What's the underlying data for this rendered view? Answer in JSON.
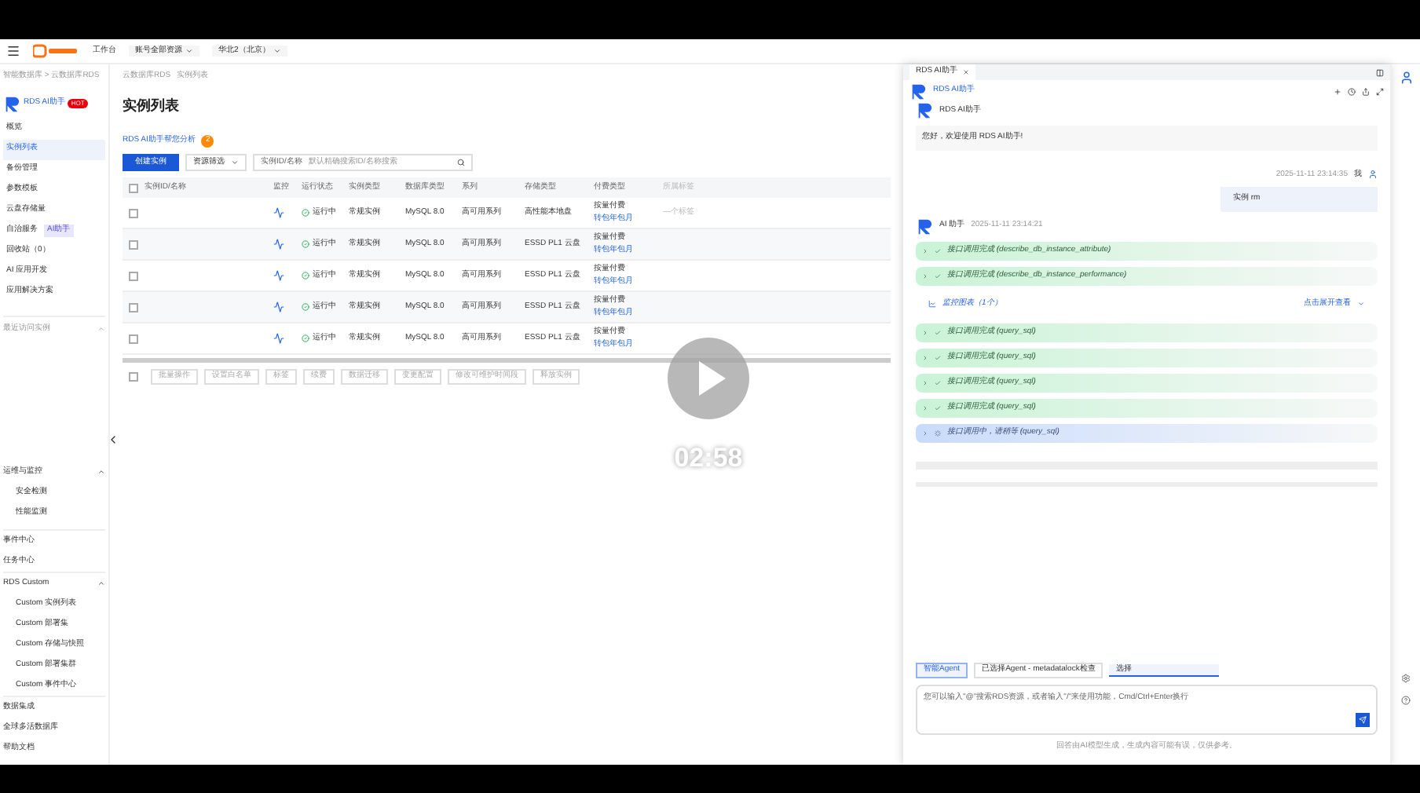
{
  "topbar": {
    "home": "工作台",
    "resources": "账号全部资源",
    "region": "华北2（北京）"
  },
  "sidebar": {
    "breadcrumb": "智能数据库 > 云数据库RDS",
    "assistant": "RDS AI助手",
    "badge": "HOT",
    "items": [
      {
        "label": "概览",
        "selected": false
      },
      {
        "label": "实例列表",
        "selected": true
      },
      {
        "label": "备份管理",
        "selected": false
      },
      {
        "label": "参数模板",
        "selected": false
      },
      {
        "label": "云盘存储量",
        "selected": false
      },
      {
        "label": "自治服务",
        "tag": "AI助手",
        "selected": false
      },
      {
        "label": "回收站（0）",
        "selected": false
      },
      {
        "label": "AI 应用开发",
        "selected": false
      },
      {
        "label": "应用解决方案",
        "selected": false
      }
    ],
    "recent": "最近访问实例",
    "groups": [
      {
        "title": "运维与监控",
        "items": [
          "安全检测",
          "性能监测"
        ]
      }
    ],
    "links": [
      "事件中心",
      "任务中心"
    ],
    "custom": {
      "title": "RDS Custom",
      "items": [
        "Custom 实例列表",
        "Custom 部署集",
        "Custom 存储与快照",
        "Custom 部署集群",
        "Custom 事件中心"
      ]
    },
    "footer": [
      "数据集成",
      "全球多活数据库",
      "帮助文档"
    ]
  },
  "main": {
    "breadcrumb": [
      "云数据库RDS",
      "实例列表"
    ],
    "title": "实例列表",
    "ai_link": "RDS AI助手帮您分析",
    "ai_count": "2",
    "create": "创建实例",
    "filter": "资源筛选",
    "search_select": "实例ID/名称",
    "search_placeholder": "默认精确搜索ID/名称搜索",
    "select_all": {
      "checked": false
    },
    "table": {
      "columns": [
        "实例ID/名称",
        "监控",
        "运行状态",
        "实例类型",
        "数据库类型",
        "系列",
        "存储类型",
        "付费类型",
        "所属标签"
      ],
      "rows": [
        {
          "status": "运行中",
          "type": "常规实例",
          "db": "MySQL 8.0",
          "series": "高可用系列",
          "storage": "高性能本地盘",
          "pay": "按量付费",
          "pay_link": "转包年包月",
          "tag": "—个标签",
          "checked": false
        },
        {
          "status": "运行中",
          "type": "常规实例",
          "db": "MySQL 8.0",
          "series": "高可用系列",
          "storage": "ESSD PL1 云盘",
          "pay": "按量付费",
          "pay_link": "转包年包月",
          "checked": false
        },
        {
          "status": "运行中",
          "type": "常规实例",
          "db": "MySQL 8.0",
          "series": "高可用系列",
          "storage": "ESSD PL1 云盘",
          "pay": "按量付费",
          "pay_link": "转包年包月",
          "checked": false
        },
        {
          "status": "运行中",
          "type": "常规实例",
          "db": "MySQL 8.0",
          "series": "高可用系列",
          "storage": "ESSD PL1 云盘",
          "pay": "按量付费",
          "pay_link": "转包年包月",
          "checked": false
        },
        {
          "status": "运行中",
          "type": "常规实例",
          "db": "MySQL 8.0",
          "series": "高可用系列",
          "storage": "ESSD PL1 云盘",
          "pay": "按量付费",
          "pay_link": "转包年包月",
          "checked": false
        }
      ]
    },
    "actions": [
      "批量操作",
      "设置白名单",
      "标签",
      "续费",
      "数据迁移",
      "变更配置",
      "修改可维护时间段",
      "释放实例"
    ]
  },
  "player": {
    "time": "02:58"
  },
  "assistant": {
    "tab": "RDS AI助手",
    "title": "RDS AI助手",
    "welcome_name": "RDS AI助手",
    "welcome": "您好，欢迎使用 RDS AI助手!",
    "user_time": "2025-11-11 23:14:35",
    "user_name": "我",
    "user_message": "实例 rm",
    "ai_name": "AI 助手",
    "ai_time": "2025-11-11 23:14:21",
    "steps": [
      {
        "kind": "done",
        "text": "接口调用完成 (describe_db_instance_attribute)"
      },
      {
        "kind": "done",
        "text": "接口调用完成 (describe_db_instance_performance)"
      },
      {
        "kind": "chart",
        "text": "监控图表（1个）",
        "action": "点击展开查看"
      },
      {
        "kind": "done",
        "text": "接口调用完成 (query_sql)"
      },
      {
        "kind": "done",
        "text": "接口调用完成 (query_sql)"
      },
      {
        "kind": "done",
        "text": "接口调用完成 (query_sql)"
      },
      {
        "kind": "done",
        "text": "接口调用完成 (query_sql)"
      },
      {
        "kind": "running",
        "text": "接口调用中，请稍等 (query_sql)"
      }
    ],
    "chips": [
      "智能Agent",
      "已选择Agent - metadatalock检查"
    ],
    "chip_input": "选择",
    "input_placeholder": "您可以输入\"@\"搜索RDS资源，或者输入\"/\"来使用功能，Cmd/Ctrl+Enter换行",
    "disclaimer": "回答由AI模型生成，生成内容可能有误，仅供参考。"
  }
}
